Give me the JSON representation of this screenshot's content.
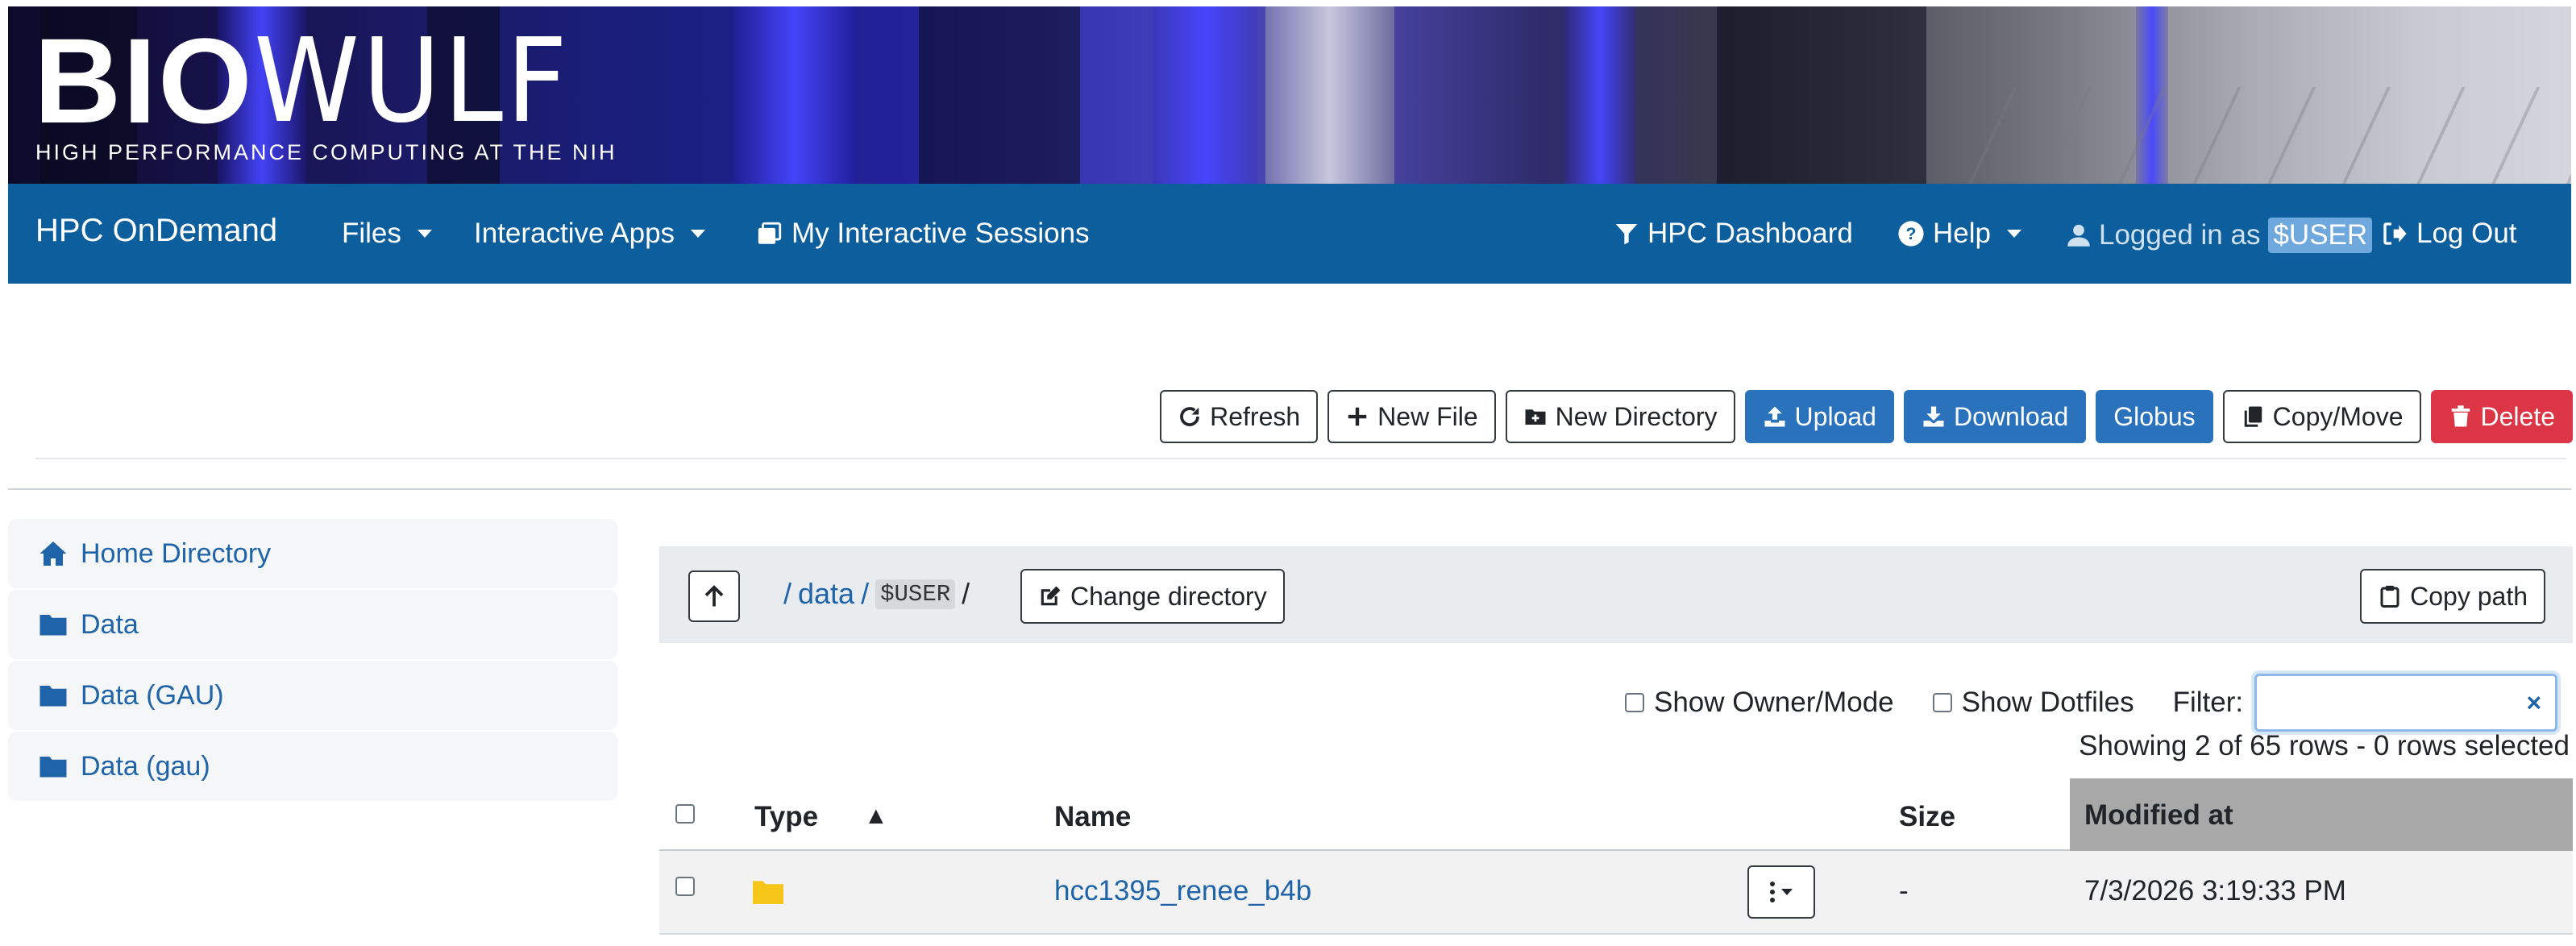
{
  "banner": {
    "logo_bio": "BIO",
    "logo_wulf": "WULF",
    "subtitle": "HIGH PERFORMANCE COMPUTING AT THE NIH"
  },
  "navbar": {
    "brand": "HPC OnDemand",
    "files": "Files",
    "interactive_apps": "Interactive Apps",
    "sessions": "My Interactive Sessions",
    "dashboard": "HPC Dashboard",
    "help": "Help",
    "logged_in_prefix": "Logged in as",
    "user": "$USER",
    "logout": "Log Out",
    "color": "#0d5e9c"
  },
  "toolbar": {
    "refresh": "Refresh",
    "new_file": "New File",
    "new_directory": "New Directory",
    "upload": "Upload",
    "download": "Download",
    "globus": "Globus",
    "copy_move": "Copy/Move",
    "delete": "Delete"
  },
  "sidebar": {
    "items": [
      {
        "label": "Home Directory",
        "icon": "home-icon"
      },
      {
        "label": "Data",
        "icon": "folder-icon"
      },
      {
        "label": "Data (GAU)",
        "icon": "folder-icon"
      },
      {
        "label": "Data (gau)",
        "icon": "folder-icon"
      }
    ]
  },
  "path": {
    "root_sep": "/",
    "segment_data": "data",
    "sep": "/",
    "segment_user": "$USER",
    "trailing": "/",
    "change_directory": "Change directory",
    "copy_path": "Copy path"
  },
  "options": {
    "show_owner_mode": "Show Owner/Mode",
    "show_dotfiles": "Show Dotfiles",
    "filter_label": "Filter:",
    "filter_value": "",
    "clear": "×"
  },
  "status": {
    "showing": "Showing 2 of 65 rows - 0 rows selected"
  },
  "table": {
    "headers": {
      "type": "Type",
      "sort_indicator": "▲",
      "name": "Name",
      "size": "Size",
      "modified": "Modified at"
    },
    "rows": [
      {
        "type_icon": "folder-icon",
        "name": "hcc1395_renee_b4b",
        "size": "-",
        "modified": "7/3/2026 3:19:33 PM"
      }
    ]
  }
}
